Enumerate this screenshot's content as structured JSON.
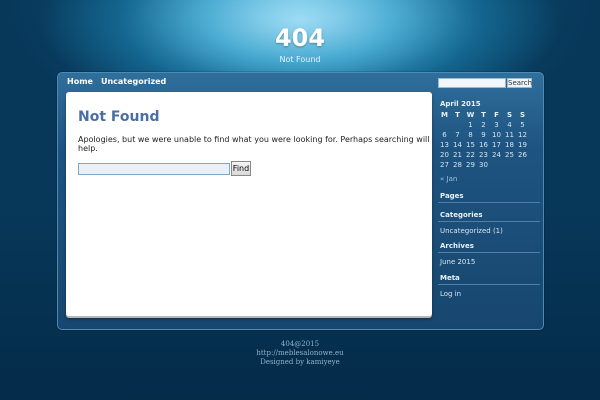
{
  "site": {
    "title": "404",
    "description": "Not Found"
  },
  "nav": {
    "items": [
      "Home",
      "Uncategorized"
    ]
  },
  "content": {
    "heading": "Not Found",
    "message": "Apologies, but we were unable to find what you were looking for. Perhaps searching will help.",
    "search_value": "",
    "find_label": "Find"
  },
  "sidebar": {
    "search_value": "",
    "search_label": "Search",
    "calendar": {
      "caption": "April 2015",
      "weekdays": [
        "M",
        "T",
        "W",
        "T",
        "F",
        "S",
        "S"
      ],
      "weeks": [
        [
          "",
          "",
          "1",
          "2",
          "3",
          "4",
          "5"
        ],
        [
          "6",
          "7",
          "8",
          "9",
          "10",
          "11",
          "12"
        ],
        [
          "13",
          "14",
          "15",
          "16",
          "17",
          "18",
          "19"
        ],
        [
          "20",
          "21",
          "22",
          "23",
          "24",
          "25",
          "26"
        ],
        [
          "27",
          "28",
          "29",
          "30",
          "",
          "",
          ""
        ]
      ],
      "prev": "« Jan"
    },
    "pages_heading": "Pages",
    "categories_heading": "Categories",
    "categories": [
      "Uncategorized (1)"
    ],
    "archives_heading": "Archives",
    "archives": [
      "June 2015"
    ],
    "meta_heading": "Meta",
    "meta": [
      "Log in"
    ]
  },
  "footer": {
    "line1": "404@2015",
    "line2": "http://meblesalonowe.eu",
    "line3": "Designed by kamiyeye"
  }
}
